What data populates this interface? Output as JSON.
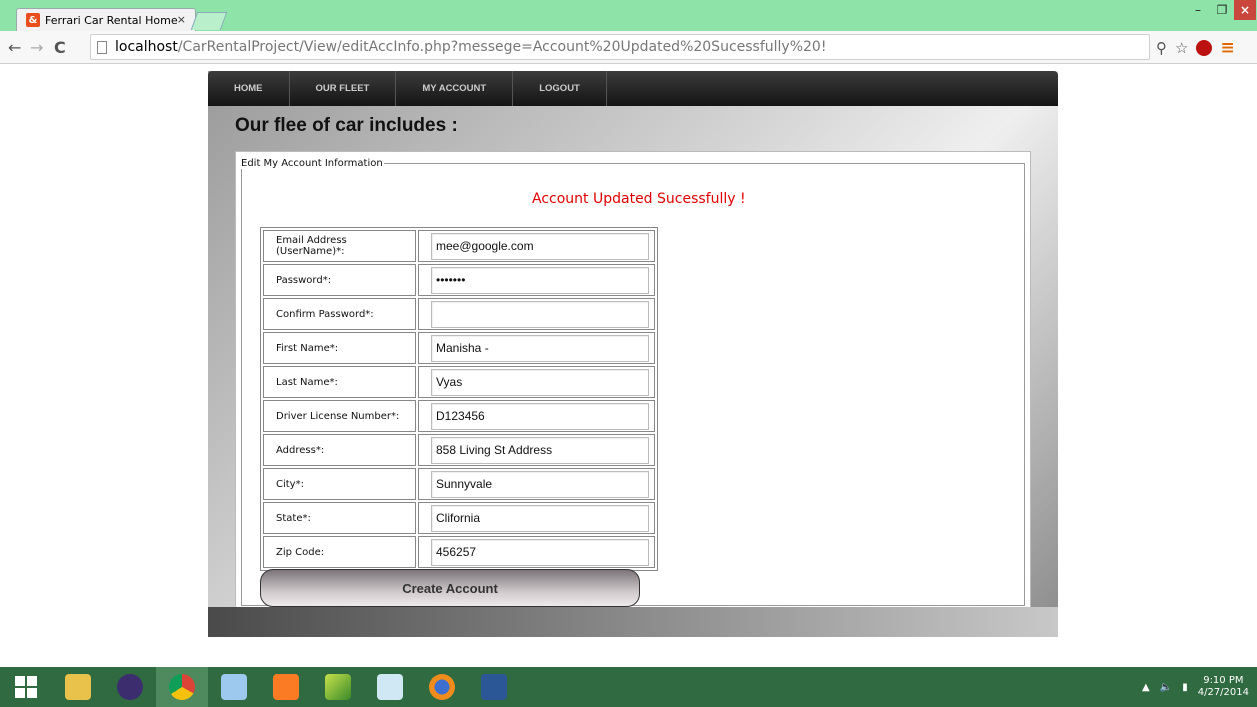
{
  "browser": {
    "tab_title": "Ferrari Car Rental Home",
    "tab_close": "×",
    "favicon_glyph": "&",
    "url_host": "localhost",
    "url_path": "/CarRentalProject/View/editAccInfo.php?messege=Account%20Updated%20Sucessfully%20!",
    "window_controls": {
      "minimize": "–",
      "maximize": "❐",
      "close": "×"
    },
    "nav": {
      "back": "←",
      "forward": "→",
      "reload": "C"
    },
    "icons": {
      "search": "⚲",
      "star": "☆",
      "menu": "≡"
    }
  },
  "site": {
    "nav_items": [
      "HOME",
      "OUR FLEET",
      "MY ACCOUNT",
      "LOGOUT"
    ],
    "page_title": "Our flee of car includes :"
  },
  "form": {
    "legend": "Edit My Account Information",
    "success_message": "Account Updated Sucessfully !",
    "fields": [
      {
        "label": "Email Address (UserName)*:",
        "value": "mee@google.com",
        "type": "text"
      },
      {
        "label": "Password*:",
        "value": "•••••••",
        "type": "password"
      },
      {
        "label": "Confirm Password*:",
        "value": "",
        "type": "password"
      },
      {
        "label": "First Name*:",
        "value": "Manisha -",
        "type": "text"
      },
      {
        "label": "Last Name*:",
        "value": "Vyas",
        "type": "text"
      },
      {
        "label": "Driver License Number*:",
        "value": "D123456",
        "type": "text"
      },
      {
        "label": "Address*:",
        "value": "858 Living St Address",
        "type": "text"
      },
      {
        "label": "City*:",
        "value": "Sunnyvale",
        "type": "text"
      },
      {
        "label": "State*:",
        "value": "Clifornia",
        "type": "text"
      },
      {
        "label": "Zip Code:",
        "value": "456257",
        "type": "text"
      }
    ],
    "submit_label": "Create Account"
  },
  "taskbar": {
    "apps": [
      "windows-start",
      "file-explorer",
      "eclipse",
      "chrome",
      "virtualbox",
      "xampp",
      "app-green",
      "notepad",
      "firefox",
      "word"
    ],
    "active": "chrome",
    "time": "9:10 PM",
    "date": "4/27/2014"
  },
  "colors": {
    "tabbar": "#8ee4a8",
    "success": "#e00000",
    "taskbar": "#2f6a40"
  }
}
